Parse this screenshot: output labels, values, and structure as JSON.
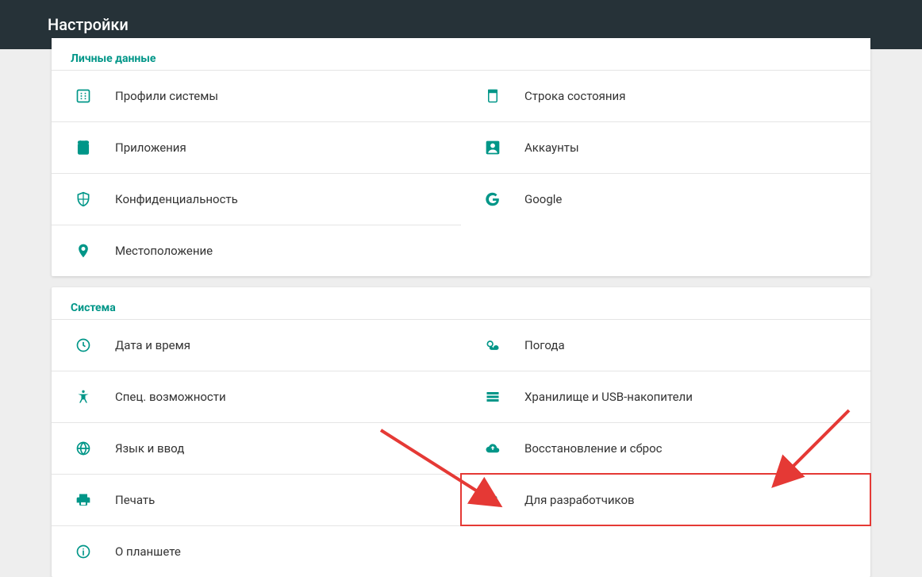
{
  "appbar": {
    "title": "Настройки"
  },
  "sections": {
    "personal": {
      "title": "Личные данные",
      "left": [
        {
          "label": "Профили системы",
          "icon": "profile-icon"
        },
        {
          "label": "Приложения",
          "icon": "apps-icon"
        },
        {
          "label": "Конфиденциальность",
          "icon": "privacy-icon"
        },
        {
          "label": "Местоположение",
          "icon": "location-icon"
        }
      ],
      "right": [
        {
          "label": "Строка состояния",
          "icon": "statusbar-icon"
        },
        {
          "label": "Аккаунты",
          "icon": "accounts-icon"
        },
        {
          "label": "Google",
          "icon": "google-icon"
        }
      ]
    },
    "system": {
      "title": "Система",
      "left": [
        {
          "label": "Дата и время",
          "icon": "clock-icon"
        },
        {
          "label": "Спец. возможности",
          "icon": "accessibility-icon"
        },
        {
          "label": "Язык и ввод",
          "icon": "language-icon"
        },
        {
          "label": "Печать",
          "icon": "print-icon"
        },
        {
          "label": "О планшете",
          "icon": "about-icon"
        }
      ],
      "right": [
        {
          "label": "Погода",
          "icon": "weather-icon"
        },
        {
          "label": "Хранилище и USB-накопители",
          "icon": "storage-icon"
        },
        {
          "label": "Восстановление и сброс",
          "icon": "backup-icon"
        },
        {
          "label": "Для разработчиков",
          "icon": "developer-icon",
          "highlighted": true
        }
      ]
    }
  }
}
